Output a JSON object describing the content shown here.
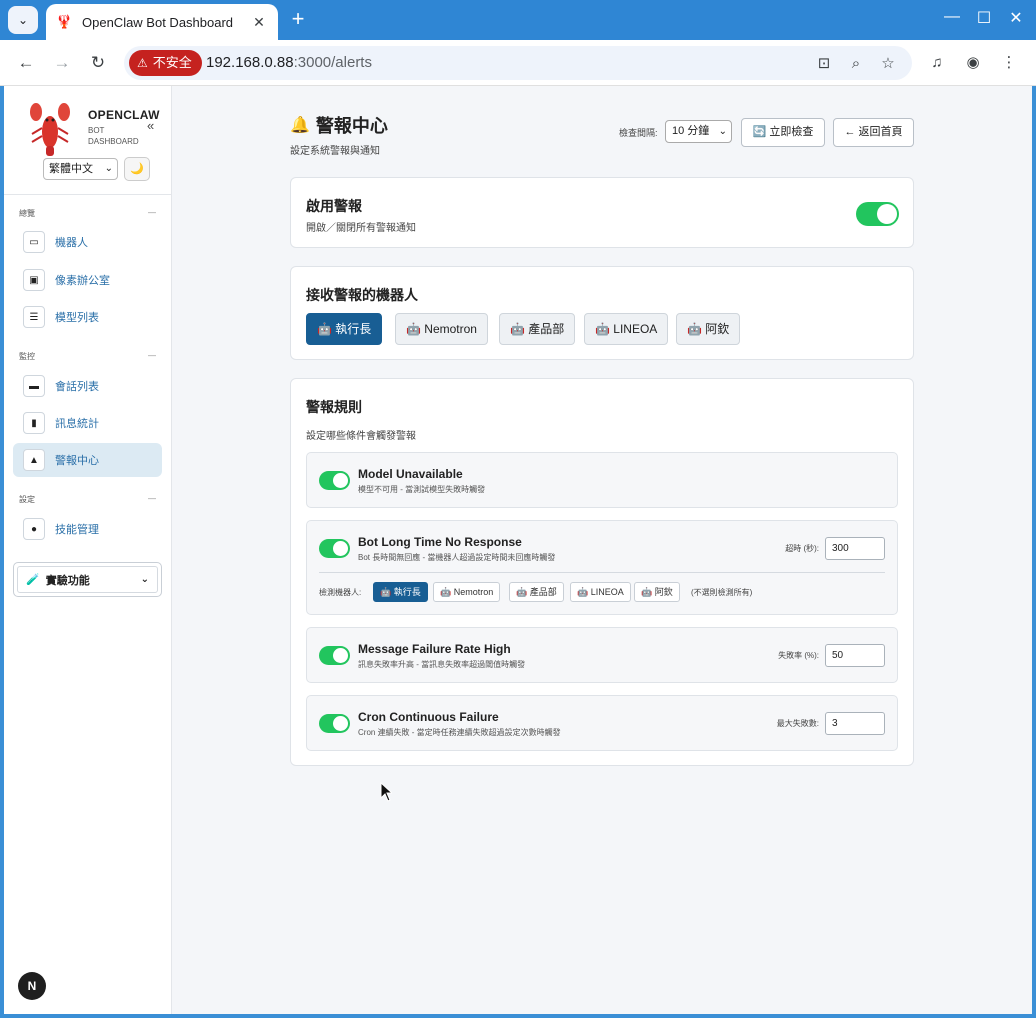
{
  "browser": {
    "tab_title": "OpenClaw Bot Dashboard",
    "security_label": "不安全",
    "url_host": "192.168.0.88",
    "url_path": ":3000/alerts"
  },
  "sidebar": {
    "brand_name": "OPENCLAW",
    "brand_sub_1": "BOT",
    "brand_sub_2": "DASHBOARD",
    "language": "繁體中文",
    "sections": [
      {
        "label": "總覽",
        "items": [
          {
            "label": "機器人",
            "icon": "robot-icon"
          },
          {
            "label": "像素辦公室",
            "icon": "office-icon"
          },
          {
            "label": "模型列表",
            "icon": "list-icon"
          }
        ]
      },
      {
        "label": "監控",
        "items": [
          {
            "label": "會話列表",
            "icon": "chat-icon"
          },
          {
            "label": "訊息統計",
            "icon": "chart-icon"
          },
          {
            "label": "警報中心",
            "icon": "bell-icon"
          }
        ]
      },
      {
        "label": "設定",
        "items": [
          {
            "label": "技能管理",
            "icon": "skill-icon"
          }
        ]
      }
    ],
    "active_item": "警報中心",
    "experiment_label": "實驗功能",
    "next_badge": "N"
  },
  "page": {
    "title": "警報中心",
    "subtitle": "設定系統警報與通知",
    "interval_label": "檢查間隔:",
    "interval_value": "10 分鐘",
    "check_now": "🔄 立即檢查",
    "back_home": "← 返回首頁"
  },
  "enable_card": {
    "title": "啟用警報",
    "subtitle": "開啟／關閉所有警報通知",
    "enabled": true
  },
  "bots_card": {
    "title": "接收警報的機器人",
    "bots": [
      {
        "label": "🤖 執行長",
        "selected": true
      },
      {
        "label": "🤖 Nemotron",
        "selected": false
      },
      {
        "label": "🤖 產品部",
        "selected": false
      },
      {
        "label": "🤖 LINEOA",
        "selected": false
      },
      {
        "label": "🤖 阿欽",
        "selected": false
      }
    ]
  },
  "rules_card": {
    "title": "警報規則",
    "subtitle": "設定哪些條件會觸發警報",
    "rules": [
      {
        "name": "Model Unavailable",
        "desc": "模型不可用 - 當測試模型失敗時觸發",
        "enabled": true
      },
      {
        "name": "Bot Long Time No Response",
        "desc": "Bot 長時間無回應 - 當機器人超過設定時間未回應時觸發",
        "enabled": true,
        "param_label": "超時 (秒):",
        "param_value": "300",
        "detect_label": "檢測機器人:",
        "detect_bots": [
          {
            "label": "🤖 執行長",
            "selected": true
          },
          {
            "label": "🤖 Nemotron",
            "selected": false
          },
          {
            "label": "🤖 產品部",
            "selected": false
          },
          {
            "label": "🤖 LINEOA",
            "selected": false
          },
          {
            "label": "🤖 阿欽",
            "selected": false
          }
        ],
        "detect_hint": "(不選則檢測所有)"
      },
      {
        "name": "Message Failure Rate High",
        "desc": "訊息失敗率升高 - 當訊息失敗率超過閾值時觸發",
        "enabled": true,
        "param_label": "失敗率 (%):",
        "param_value": "50"
      },
      {
        "name": "Cron Continuous Failure",
        "desc": "Cron 連續失敗 - 當定時任務連續失敗超過設定次數時觸發",
        "enabled": true,
        "param_label": "最大失敗數:",
        "param_value": "3"
      }
    ]
  },
  "colors": {
    "accent": "#185e94",
    "toggle_on": "#22c55e",
    "nav_active_bg": "#dceaf3",
    "insecure_red": "#c5221f"
  }
}
